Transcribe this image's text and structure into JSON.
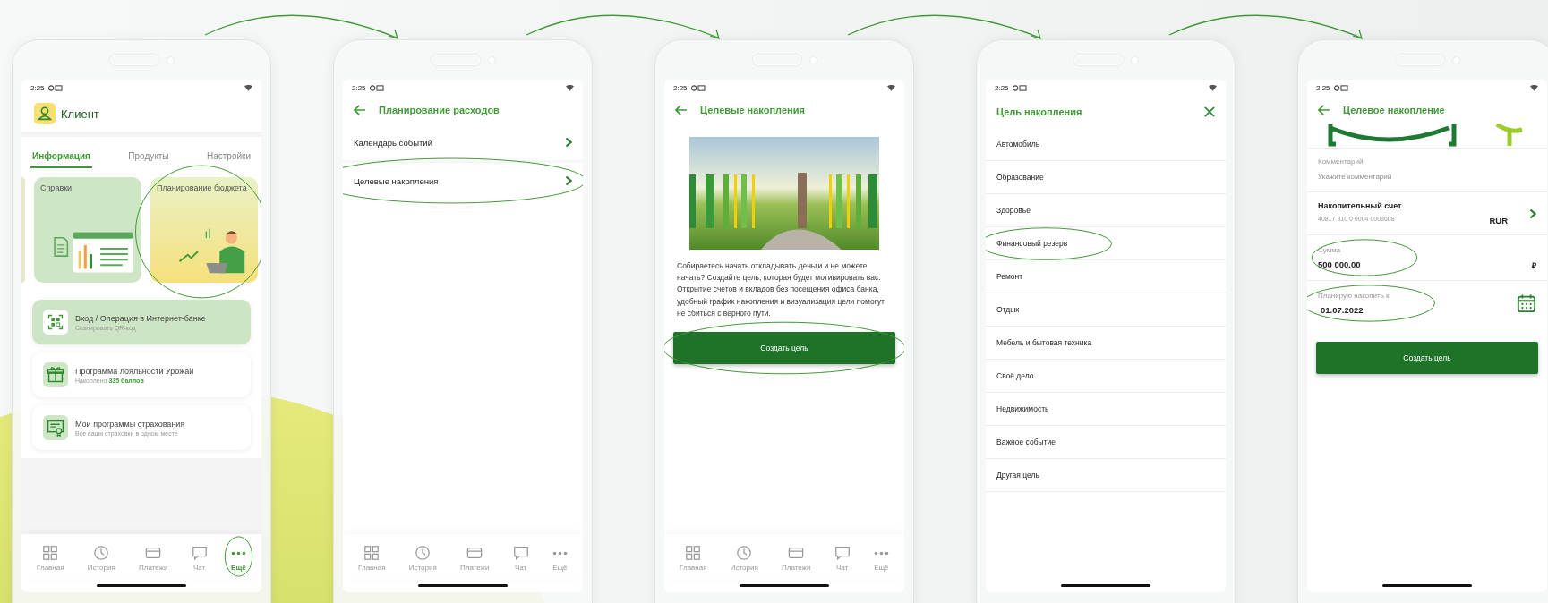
{
  "screens": [
    {
      "kind": "profile",
      "status_time": "2:25",
      "user_name": "Клиент",
      "tabs": [
        {
          "label": "Информация",
          "selected": true
        },
        {
          "label": "Продукты",
          "selected": false
        },
        {
          "label": "Настройки",
          "selected": false
        }
      ],
      "tiles": [
        {
          "title": "Справки",
          "circled": false
        },
        {
          "title": "Планирование бюджета",
          "circled": true
        }
      ],
      "cards": [
        {
          "title": "Вход / Операция в Интернет-банке",
          "subtitle": "Сканировать QR-код",
          "highlighted": true
        },
        {
          "title": "Программа лояльности Урожай",
          "subtitle": "Накоплено **335 баллов**",
          "highlighted": false
        },
        {
          "title": "Мои программы страхования",
          "subtitle": "Все ваши страховки в одном месте",
          "highlighted": false
        }
      ],
      "nav": [
        {
          "label": "Главная",
          "selected": false,
          "circled": false
        },
        {
          "label": "История",
          "selected": false,
          "circled": false
        },
        {
          "label": "Платежи",
          "selected": false,
          "circled": false
        },
        {
          "label": "Чат",
          "selected": false,
          "circled": false
        },
        {
          "label": "Ещё",
          "selected": true,
          "circled": true
        }
      ]
    },
    {
      "kind": "menu",
      "status_time": "2:25",
      "title": "Планирование расходов",
      "items": [
        {
          "label": "Календарь событий",
          "circled": false
        },
        {
          "label": "Целевые накопления",
          "circled": true
        }
      ],
      "nav": [
        {
          "label": "Главная",
          "selected": false,
          "circled": false
        },
        {
          "label": "История",
          "selected": false,
          "circled": false
        },
        {
          "label": "Платежи",
          "selected": false,
          "circled": false
        },
        {
          "label": "Чат",
          "selected": false,
          "circled": false
        },
        {
          "label": "Ещё",
          "selected": false,
          "circled": false
        }
      ]
    },
    {
      "kind": "intro",
      "status_time": "2:25",
      "title": "Целевые накопления",
      "text": "Собираетесь начать откладывать деньги и не можете начать? Создайте цель, которая будет мотивировать вас. Открытие счетов и вкладов без посещения офиса банка, удобный график накопления и визуализация цели помогут не сбиться с верного пути.",
      "button": {
        "label": "Создать цель",
        "circled": true
      },
      "nav": [
        {
          "label": "Главная",
          "selected": false,
          "circled": false
        },
        {
          "label": "История",
          "selected": false,
          "circled": false
        },
        {
          "label": "Платежи",
          "selected": false,
          "circled": false
        },
        {
          "label": "Чат",
          "selected": false,
          "circled": false
        },
        {
          "label": "Ещё",
          "selected": false,
          "circled": false
        }
      ]
    },
    {
      "kind": "picker",
      "status_time": "2:25",
      "title": "Цель накопления",
      "options": [
        {
          "label": "Автомобиль",
          "circled": false
        },
        {
          "label": "Образование",
          "circled": false
        },
        {
          "label": "Здоровье",
          "circled": false
        },
        {
          "label": "Финансовый резерв",
          "circled": true
        },
        {
          "label": "Ремонт",
          "circled": false
        },
        {
          "label": "Отдых",
          "circled": false
        },
        {
          "label": "Мебель и бытовая техника",
          "circled": false
        },
        {
          "label": "Своё дело",
          "circled": false
        },
        {
          "label": "Недвижимость",
          "circled": false
        },
        {
          "label": "Важное событие",
          "circled": false
        },
        {
          "label": "Другая цель",
          "circled": false
        }
      ]
    },
    {
      "kind": "form",
      "status_time": "2:25",
      "title": "Целевое накопление",
      "comment": {
        "label": "Комментарий",
        "placeholder": "Укажите комментарий"
      },
      "account": {
        "title": "Накопительный счет",
        "number": "40817 810 0 0004 0008608",
        "currency": "RUR"
      },
      "amount": {
        "label": "Сумма",
        "value": "500 000.00",
        "currency": "₽",
        "circled": true
      },
      "date": {
        "label": "Планирую накопить к",
        "value": "01.07.2022",
        "circled": true
      },
      "button": {
        "label": "Создать цель",
        "circled": false
      }
    }
  ]
}
